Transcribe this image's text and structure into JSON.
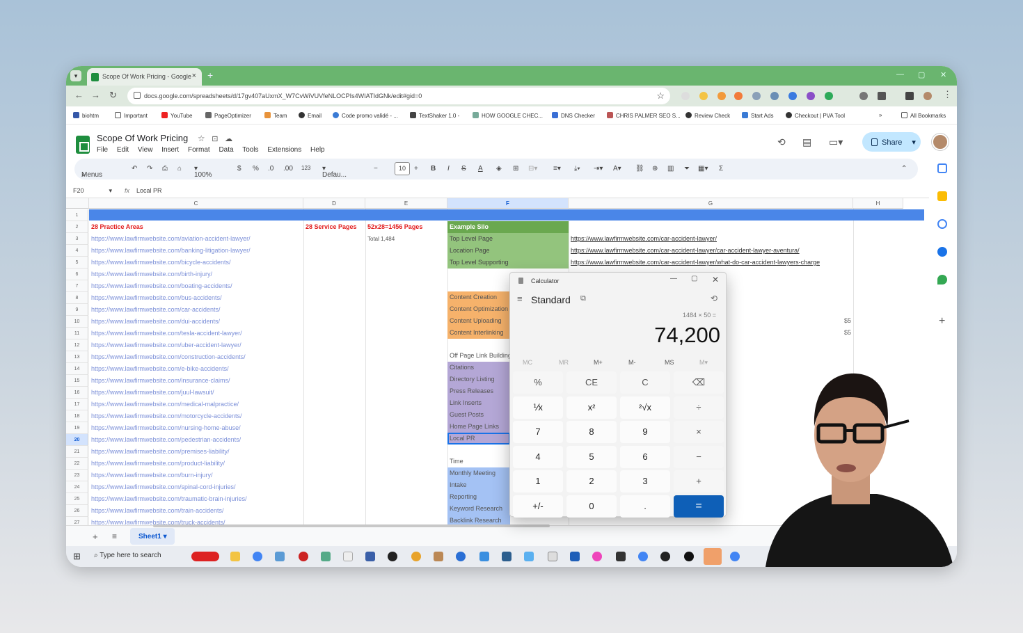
{
  "browser": {
    "tab_title": "Scope Of Work Pricing - Google",
    "url": "docs.google.com/spreadsheets/d/17gv407aUxmX_W7CvWiVUVfeNLOCPIs4WIATIdGNk/edit#gid=0",
    "bookmarks": [
      "biohtm",
      "Important",
      "YouTube",
      "PageOptimizer",
      "Team",
      "Email",
      "Code promo validé - ...",
      "TextShaker 1.0 -",
      "HOW GOOGLE CHEC...",
      "DNS Checker",
      "CHRIS PALMER SEO S...",
      "Review Check",
      "Start Ads",
      "Checkout | PVA Tool",
      "All Bookmarks"
    ]
  },
  "sheets": {
    "doc_title": "Scope Of Work Pricing",
    "menus": [
      "File",
      "Edit",
      "View",
      "Insert",
      "Format",
      "Data",
      "Tools",
      "Extensions",
      "Help"
    ],
    "share_label": "Share",
    "toolbar": {
      "search": "Menus",
      "zoom": "100%",
      "currency": "$",
      "percent": "%",
      "dec_dec": ".0",
      "inc_dec": ".00",
      "format123": "123",
      "font": "Defau...",
      "font_size": "10",
      "bold": "B",
      "italic": "I",
      "sum": "Σ"
    },
    "name_box": "F20",
    "fx": "fx",
    "formula": "Local PR",
    "columns": [
      "C",
      "D",
      "E",
      "F",
      "G",
      "H"
    ],
    "row_numbers": [
      "1",
      "2",
      "3",
      "4",
      "5",
      "6",
      "7",
      "8",
      "9",
      "10",
      "11",
      "12",
      "13",
      "14",
      "15",
      "16",
      "17",
      "18",
      "19",
      "20",
      "21",
      "22",
      "23",
      "24",
      "25",
      "26",
      "27"
    ],
    "selected_row": "20",
    "c_header": "28 Practice Areas",
    "d_header": "28 Service Pages",
    "e_header": "52x28=1456 Pages",
    "e_total": "Total 1,484",
    "c_links": [
      "https://www.lawfirmwebsite.com/aviation-accident-lawyer/",
      "https://www.lawfirmwebsite.com/banking-litigation-lawyer/",
      "https://www.lawfirmwebsite.com/bicycle-accidents/",
      "https://www.lawfirmwebsite.com/birth-injury/",
      "https://www.lawfirmwebsite.com/boating-accidents/",
      "https://www.lawfirmwebsite.com/bus-accidents/",
      "https://www.lawfirmwebsite.com/car-accidents/",
      "https://www.lawfirmwebsite.com/dui-accidents/",
      "https://www.lawfirmwebsite.com/tesla-accident-lawyer/",
      "https://www.lawfirmwebsite.com/uber-accident-lawyer/",
      "https://www.lawfirmwebsite.com/construction-accidents/",
      "https://www.lawfirmwebsite.com/e-bike-accidents/",
      "https://www.lawfirmwebsite.com/insurance-claims/",
      "https://www.lawfirmwebsite.com/juul-lawsuit/",
      "https://www.lawfirmwebsite.com/medical-malpractice/",
      "https://www.lawfirmwebsite.com/motorcycle-accidents/",
      "https://www.lawfirmwebsite.com/nursing-home-abuse/",
      "https://www.lawfirmwebsite.com/pedestrian-accidents/",
      "https://www.lawfirmwebsite.com/premises-liability/",
      "https://www.lawfirmwebsite.com/product-liability/",
      "https://www.lawfirmwebsite.com/burn-injury/",
      "https://www.lawfirmwebsite.com/spinal-cord-injuries/",
      "https://www.lawfirmwebsite.com/traumatic-brain-injuries/",
      "https://www.lawfirmwebsite.com/train-accidents/",
      "https://www.lawfirmwebsite.com/truck-accidents/"
    ],
    "f_header": "Example Silo",
    "f_silo": [
      "Top Level Page",
      "Location Page",
      "Top Level Supporting"
    ],
    "g_links": [
      "https://www.lawfirmwebsite.com/car-accident-lawyer/",
      "https://www.lawfirmwebsite.com/car-accident-lawyer/car-accident-lawyer-aventura/",
      "https://www.lawfirmwebsite.com/car-accident-lawyer/what-do-car-accident-lawyers-charge"
    ],
    "f_content": [
      "Content Creation",
      "Content Optimization",
      "Content Uploading",
      "Content Interlinking"
    ],
    "h_prices": [
      "$5",
      "$5"
    ],
    "f_offpage": "Off Page Link Building",
    "f_links": [
      "Citations",
      "Directory Listing",
      "Press Releases",
      "Link Inserts",
      "Guest Posts",
      "Home Page Links",
      "Local PR"
    ],
    "f_time": "Time",
    "f_time_items": [
      "Monthly Meeting",
      "Intake",
      "Reporting",
      "Keyword Research",
      "Backlink Research"
    ],
    "sheet_tab": "Sheet1"
  },
  "calculator": {
    "title": "Calculator",
    "mode": "Standard",
    "expression": "1484 × 50 =",
    "display": "74,200",
    "memory": [
      "MC",
      "MR",
      "M+",
      "M-",
      "MS",
      "M▾"
    ],
    "keys": [
      "%",
      "CE",
      "C",
      "⌫",
      "⅟x",
      "x²",
      "²√x",
      "÷",
      "7",
      "8",
      "9",
      "×",
      "4",
      "5",
      "6",
      "−",
      "1",
      "2",
      "3",
      "+",
      "+/-",
      "0",
      ".",
      "="
    ]
  },
  "taskbar": {
    "search_placeholder": "Type here to search"
  },
  "colors": {
    "sheets_green": "#1e8e3e",
    "header_blue": "#4a86e8",
    "silo_green": "#93c47d",
    "content_orange": "#f6b26b",
    "links_purple": "#b4a7d6",
    "time_blue": "#a4c2f4",
    "calc_equals": "#0e5fb7"
  }
}
